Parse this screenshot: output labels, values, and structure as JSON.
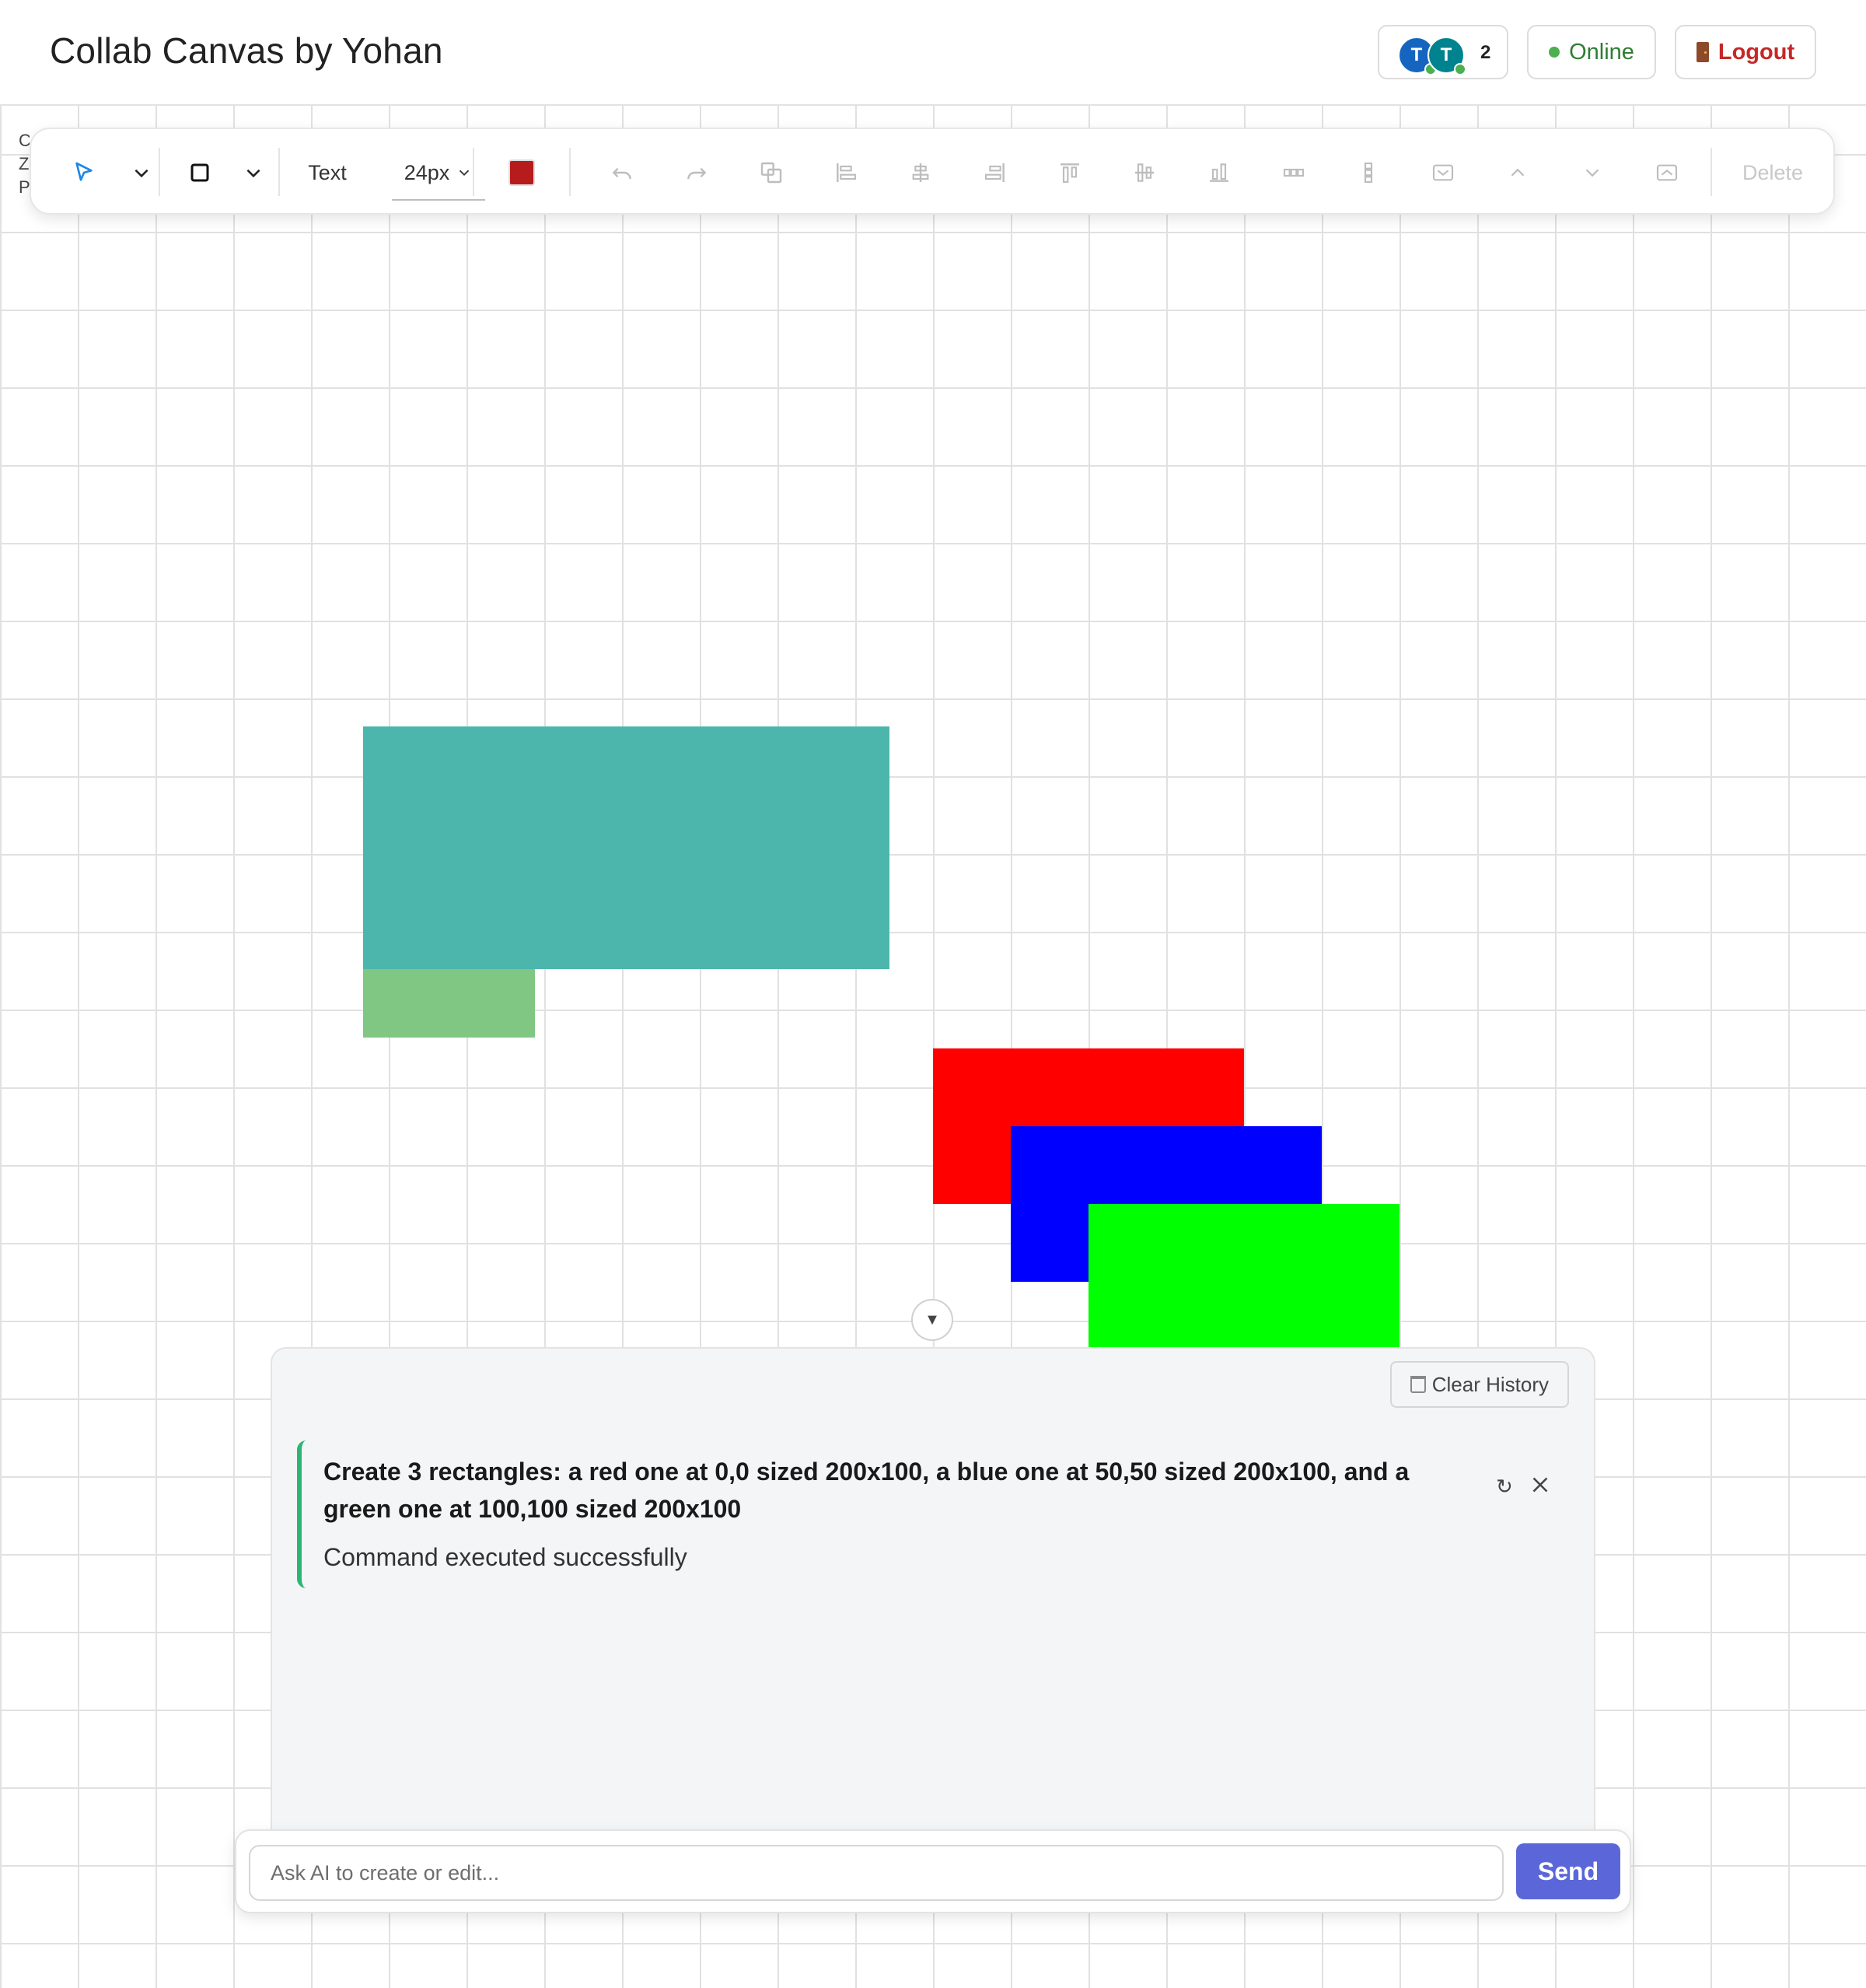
{
  "header": {
    "title": "Collab Canvas by Yohan",
    "presence": {
      "avatars": [
        {
          "initial": "T",
          "color": "#1565c0"
        },
        {
          "initial": "T",
          "color": "#00838f"
        }
      ],
      "count": "2"
    },
    "status_label": "Online",
    "logout_label": "Logout"
  },
  "toolbar": {
    "tools": [
      "select-tool",
      "rectangle-tool"
    ],
    "text_label": "Text",
    "font_size": "24px",
    "color": "#b71c1c",
    "delete_label": "Delete"
  },
  "canvas": {
    "info_lines": [
      "C",
      "Z",
      "P"
    ],
    "shapes": [
      {
        "name": "teal-rectangle",
        "color": "#4db6ac"
      },
      {
        "name": "light-green-rectangle",
        "color": "#81c784"
      },
      {
        "name": "red-rectangle",
        "color": "#ff0000"
      },
      {
        "name": "blue-rectangle",
        "color": "#0000ff"
      },
      {
        "name": "green-rectangle",
        "color": "#00ff00"
      }
    ]
  },
  "ai_panel": {
    "clear_history_label": "Clear History",
    "history": [
      {
        "command": "Create 3 rectangles: a red one at 0,0 sized 200x100, a blue one at 50,50 sized 200x100, and a green one at 100,100 sized 200x100",
        "result": "Command executed successfully"
      }
    ],
    "input_placeholder": "Ask AI to create or edit...",
    "send_label": "Send"
  }
}
